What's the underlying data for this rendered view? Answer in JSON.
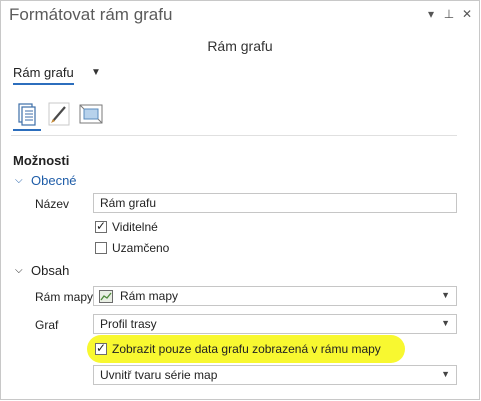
{
  "window": {
    "title": "Formátovat rám grafu"
  },
  "title_icons": {
    "dropdown": "▾",
    "pin": "⊥",
    "close": "✕"
  },
  "panel": {
    "subtitle": "Rám grafu",
    "selector": {
      "value": "Rám grafu"
    }
  },
  "tabs": [
    {
      "name": "options-icon",
      "active": true
    },
    {
      "name": "edit-icon",
      "active": false
    },
    {
      "name": "display-icon",
      "active": false
    }
  ],
  "options": {
    "title": "Možnosti",
    "general": {
      "header": "Obecné",
      "name_label": "Název",
      "name_value": "Rám grafu",
      "visible_label": "Viditelné",
      "visible_checked": true,
      "locked_label": "Uzamčeno",
      "locked_checked": false
    },
    "content": {
      "header": "Obsah",
      "map_frame_label": "Rám mapy",
      "map_frame_value": "Rám mapy",
      "graph_label": "Graf",
      "graph_value": "Profil trasy",
      "show_only_label": "Zobrazit pouze data grafu zobrazená v rámu mapy",
      "show_only_checked": true,
      "series_value": "Uvnitř tvaru série map"
    }
  },
  "colors": {
    "accent": "#2c6ebd",
    "highlight": "#f7f71a",
    "header_blue": "#1f5da8"
  }
}
